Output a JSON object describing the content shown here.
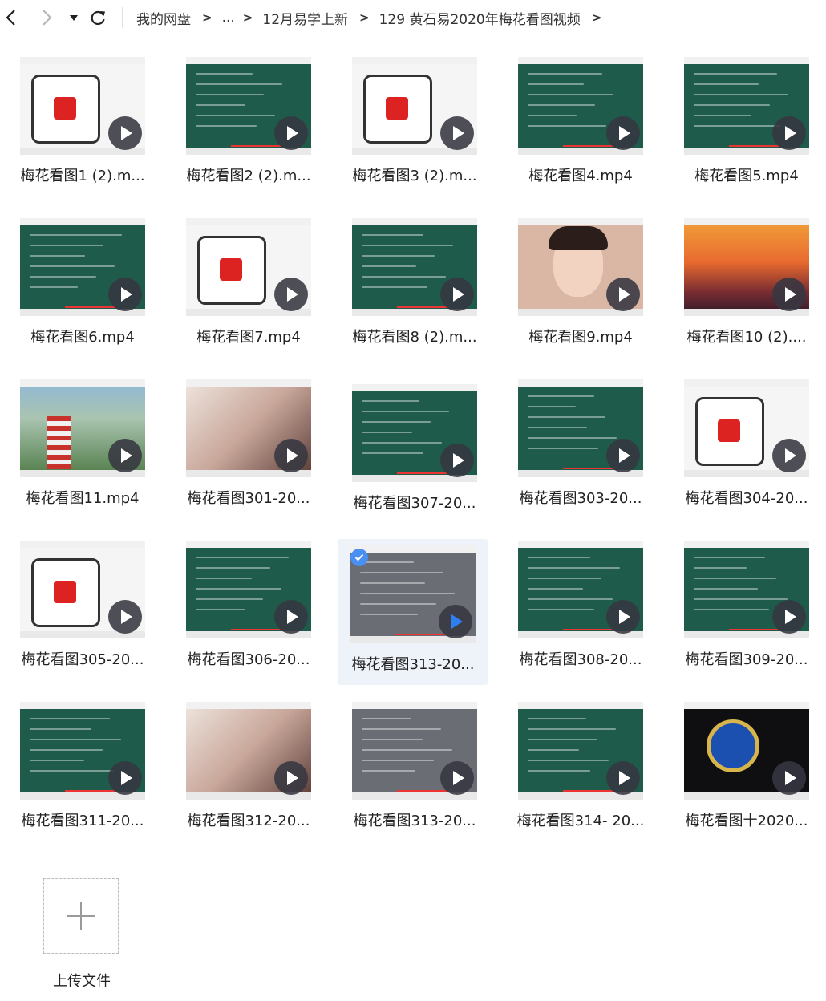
{
  "toolbar": {
    "back_icon": "chevron-left-icon",
    "forward_icon": "chevron-right-icon",
    "dropdown_icon": "caret-down-icon",
    "refresh_icon": "refresh-icon"
  },
  "breadcrumb": {
    "items": [
      "我的网盘",
      "...",
      "12月易学上新",
      "129 黄石易2020年梅花看图视频"
    ],
    "separator": ">"
  },
  "files": [
    {
      "name": "梅花看图1 (2).m...",
      "theme": "t-white",
      "selected": false
    },
    {
      "name": "梅花看图2 (2).m...",
      "theme": "t-green",
      "selected": false
    },
    {
      "name": "梅花看图3 (2).m...",
      "theme": "t-white",
      "selected": false
    },
    {
      "name": "梅花看图4.mp4",
      "theme": "t-green",
      "selected": false
    },
    {
      "name": "梅花看图5.mp4",
      "theme": "t-green",
      "selected": false
    },
    {
      "name": "梅花看图6.mp4",
      "theme": "t-green",
      "selected": false
    },
    {
      "name": "梅花看图7.mp4",
      "theme": "t-white",
      "selected": false
    },
    {
      "name": "梅花看图8 (2).m...",
      "theme": "t-green",
      "selected": false
    },
    {
      "name": "梅花看图9.mp4",
      "theme": "t-face",
      "selected": false
    },
    {
      "name": "梅花看图10 (2)....",
      "theme": "t-sunset",
      "selected": false
    },
    {
      "name": "梅花看图11.mp4",
      "theme": "t-outdoor",
      "selected": false
    },
    {
      "name": "梅花看图301-20...",
      "theme": "t-hair",
      "selected": false
    },
    {
      "name": "梅花看图307-20...",
      "theme": "t-green",
      "selected": false
    },
    {
      "name": "梅花看图303-20...",
      "theme": "t-green",
      "selected": false
    },
    {
      "name": "梅花看图304-20...",
      "theme": "t-white",
      "selected": false
    },
    {
      "name": "梅花看图305-20...",
      "theme": "t-white",
      "selected": false
    },
    {
      "name": "梅花看图306-20...",
      "theme": "t-green",
      "selected": false
    },
    {
      "name": "梅花看图313-20...",
      "theme": "t-gray",
      "selected": true
    },
    {
      "name": "梅花看图308-20...",
      "theme": "t-green",
      "selected": false
    },
    {
      "name": "梅花看图309-20...",
      "theme": "t-green",
      "selected": false
    },
    {
      "name": "梅花看图311-20...",
      "theme": "t-green",
      "selected": false
    },
    {
      "name": "梅花看图312-20...",
      "theme": "t-hair",
      "selected": false
    },
    {
      "name": "梅花看图313-20...",
      "theme": "t-gray",
      "selected": false
    },
    {
      "name": "梅花看图314- 20...",
      "theme": "t-green",
      "selected": false
    },
    {
      "name": "梅花看图十2020...",
      "theme": "t-inter",
      "selected": false
    }
  ],
  "upload": {
    "label": "上传文件",
    "icon": "plus-icon"
  },
  "colors": {
    "accent": "#4a90f2",
    "selected_bg": "#eef2f9",
    "play_overlay": "#37373f"
  }
}
